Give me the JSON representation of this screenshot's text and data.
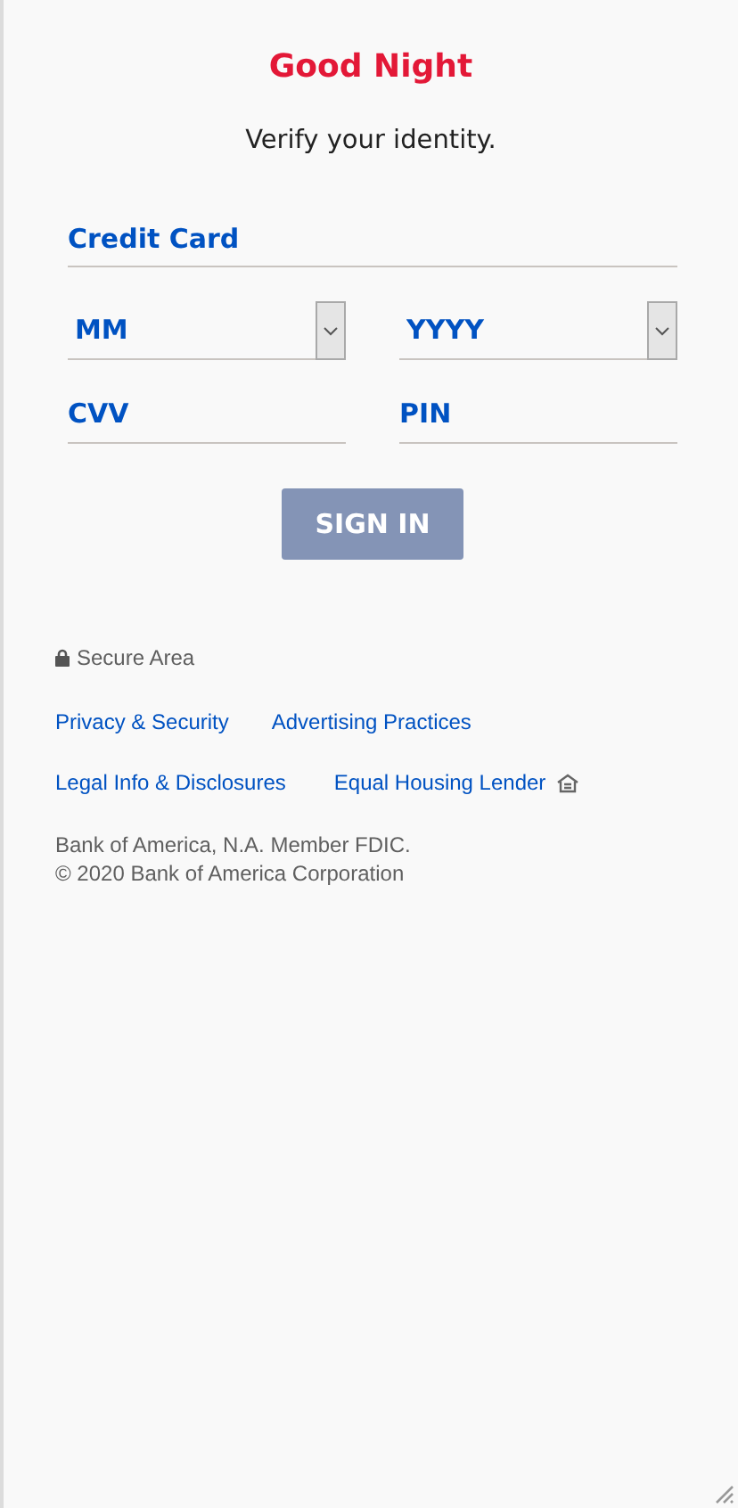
{
  "greeting": "Good Night",
  "subtitle": "Verify your identity.",
  "card_field": {
    "placeholder": "Credit Card"
  },
  "expiry": [
    {
      "placeholder": "MM"
    },
    {
      "placeholder": "YYYY"
    }
  ],
  "codes": [
    {
      "placeholder": "CVV"
    },
    {
      "placeholder": "PIN"
    }
  ],
  "sign_in": {
    "label": "SIGN IN",
    "disabled": true
  },
  "secure_area": "Secure Area",
  "links": [
    [
      "Privacy & Security",
      "Advertising Practices"
    ],
    [
      "Legal Info & Disclosures",
      "Equal Housing Lender"
    ]
  ],
  "legal": [
    "Bank of America, N.A. Member FDIC.",
    "© 2020 Bank of America Corporation"
  ]
}
